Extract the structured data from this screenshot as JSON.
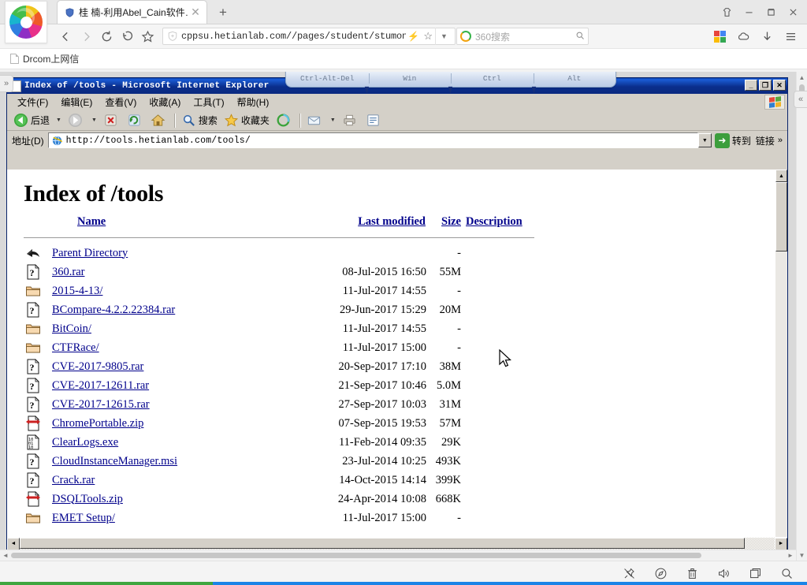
{
  "browser": {
    "tab": {
      "title": "桂 楠-利用Abel_Cain软件…",
      "shield_icon": "shield-icon",
      "close_icon": "close-icon"
    },
    "new_tab_label": "+",
    "window_controls": [
      {
        "name": "skin-button",
        "glyph": "♜"
      },
      {
        "name": "minimize-button",
        "glyph": "—"
      },
      {
        "name": "maximize-button",
        "glyph": "❐"
      },
      {
        "name": "close-button",
        "glyph": "✕"
      }
    ],
    "nav": {
      "back_glyph": "‹",
      "forward_glyph": "›",
      "reload_glyph": "⟳",
      "history_glyph": "↺",
      "star_glyph": "☆"
    },
    "url": {
      "value": "cppsu.hetianlab.com//pages/student/stumonitor.js",
      "bolt_glyph": "⚡",
      "star_glyph": "☆",
      "caret_glyph": "▼",
      "shield_icon": "shield-icon"
    },
    "search": {
      "placeholder": "360搜索",
      "engine_icon": "360-logo-icon",
      "magnifier_glyph": "🔍"
    },
    "toolbar_right": [
      {
        "name": "apps-grid-icon",
        "glyph": ""
      },
      {
        "name": "cloud-icon",
        "glyph": "☁"
      },
      {
        "name": "download-icon",
        "glyph": "↓"
      },
      {
        "name": "menu-icon",
        "glyph": "☰"
      }
    ],
    "bookmarks": [
      {
        "label": "Drcom上网信",
        "icon": "page-icon"
      }
    ]
  },
  "remote_toolbar": {
    "buttons": [
      "Ctrl-Alt-Del",
      "Win",
      "Ctrl",
      "Alt"
    ]
  },
  "ie": {
    "title": "Index of /tools - Microsoft Internet Explorer",
    "title_icon": "ie-document-icon",
    "window_buttons": [
      {
        "name": "ie-minimize-button",
        "glyph": "_"
      },
      {
        "name": "ie-restore-button",
        "glyph": "❐"
      },
      {
        "name": "ie-close-button",
        "glyph": "✕"
      }
    ],
    "menu": [
      "文件(F)",
      "编辑(E)",
      "查看(V)",
      "收藏(A)",
      "工具(T)",
      "帮助(H)"
    ],
    "toolbar": {
      "back_label": "后退",
      "search_label": "搜索",
      "favorites_label": "收藏夹",
      "items": [
        {
          "name": "back-button",
          "icon": "back-arrow-icon"
        },
        {
          "name": "forward-button",
          "icon": "forward-arrow-icon"
        },
        {
          "name": "stop-button",
          "icon": "stop-icon"
        },
        {
          "name": "refresh-button",
          "icon": "refresh-icon"
        },
        {
          "name": "home-button",
          "icon": "home-icon"
        },
        {
          "name": "search-button",
          "icon": "magnifier-icon"
        },
        {
          "name": "favorites-button",
          "icon": "star-icon"
        },
        {
          "name": "history-button",
          "icon": "history-icon"
        },
        {
          "name": "mail-button",
          "icon": "mail-icon"
        },
        {
          "name": "print-button",
          "icon": "print-icon"
        },
        {
          "name": "edit-button",
          "icon": "edit-icon"
        }
      ]
    },
    "address": {
      "label": "地址(D)",
      "value": "http://tools.hetianlab.com/tools/",
      "icon": "ie-globe-icon",
      "go_label": "转到",
      "links_label": "链接",
      "links_chevron": "»"
    }
  },
  "page": {
    "heading": "Index of /tools",
    "columns": {
      "name": "Name",
      "last_modified": "Last modified",
      "size": "Size",
      "description": "Description"
    },
    "rows": [
      {
        "icon": "parent-directory-icon",
        "name": "Parent Directory",
        "modified": "",
        "size": "-",
        "description": ""
      },
      {
        "icon": "unknown-file-icon",
        "name": "360.rar",
        "modified": "08-Jul-2015 16:50",
        "size": "55M",
        "description": ""
      },
      {
        "icon": "folder-icon",
        "name": "2015-4-13/",
        "modified": "11-Jul-2017 14:55",
        "size": "-",
        "description": ""
      },
      {
        "icon": "unknown-file-icon",
        "name": "BCompare-4.2.2.22384.rar",
        "modified": "29-Jun-2017 15:29",
        "size": "20M",
        "description": ""
      },
      {
        "icon": "folder-icon",
        "name": "BitCoin/",
        "modified": "11-Jul-2017 14:55",
        "size": "-",
        "description": ""
      },
      {
        "icon": "folder-icon",
        "name": "CTFRace/",
        "modified": "11-Jul-2017 15:00",
        "size": "-",
        "description": ""
      },
      {
        "icon": "unknown-file-icon",
        "name": "CVE-2017-9805.rar",
        "modified": "20-Sep-2017 17:10",
        "size": "38M",
        "description": ""
      },
      {
        "icon": "unknown-file-icon",
        "name": "CVE-2017-12611.rar",
        "modified": "21-Sep-2017 10:46",
        "size": "5.0M",
        "description": ""
      },
      {
        "icon": "unknown-file-icon",
        "name": "CVE-2017-12615.rar",
        "modified": "27-Sep-2017 10:03",
        "size": "31M",
        "description": ""
      },
      {
        "icon": "compressed-file-icon",
        "name": "ChromePortable.zip",
        "modified": "07-Sep-2015 19:53",
        "size": "57M",
        "description": ""
      },
      {
        "icon": "binary-file-icon",
        "name": "ClearLogs.exe",
        "modified": "11-Feb-2014 09:35",
        "size": "29K",
        "description": ""
      },
      {
        "icon": "unknown-file-icon",
        "name": "CloudInstanceManager.msi",
        "modified": "23-Jul-2014 10:25",
        "size": "493K",
        "description": ""
      },
      {
        "icon": "unknown-file-icon",
        "name": "Crack.rar",
        "modified": "14-Oct-2015 14:14",
        "size": "399K",
        "description": ""
      },
      {
        "icon": "compressed-file-icon",
        "name": "DSQLTools.zip",
        "modified": "24-Apr-2014 10:08",
        "size": "668K",
        "description": ""
      },
      {
        "icon": "folder-icon",
        "name": "EMET Setup/",
        "modified": "11-Jul-2017 15:00",
        "size": "-",
        "description": ""
      }
    ]
  },
  "bottom_bar": {
    "tools": [
      {
        "name": "pin-off-icon",
        "glyph": "pin"
      },
      {
        "name": "compass-icon",
        "glyph": "compass"
      },
      {
        "name": "trash-icon",
        "glyph": "trash"
      },
      {
        "name": "volume-icon",
        "glyph": "speaker"
      },
      {
        "name": "window-icon",
        "glyph": "window"
      },
      {
        "name": "search-icon",
        "glyph": "magnifier"
      }
    ]
  },
  "colors": {
    "ie_title_blue": "#0a2a80",
    "win_face": "#d4d0c8",
    "link_blue": "#00008b",
    "accent_green": "#3fa63f",
    "accent_blue": "#1b84e7"
  }
}
